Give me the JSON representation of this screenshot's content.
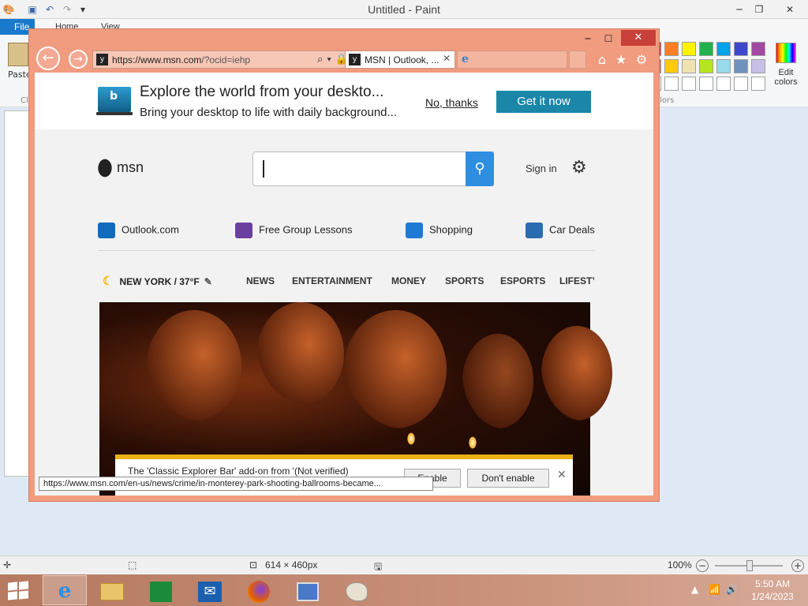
{
  "paint": {
    "title": "Untitled - Paint",
    "tabs": [
      "File",
      "Home",
      "View"
    ],
    "paste_label": "Paste",
    "clipboard_label": "Cl",
    "colors_label": "olors",
    "edit_colors_label": "Edit colors",
    "palette_row1": [
      "#e81123",
      "#ff7f27",
      "#fff200",
      "#22b14c",
      "#00a2e8",
      "#3f48cc",
      "#a349a4"
    ],
    "palette_row2": [
      "#b97a57",
      "#ffc90e",
      "#efe4b0",
      "#b5e61d",
      "#99d9ea",
      "#7092be",
      "#c8bfe7"
    ],
    "status": {
      "dimensions": "614 × 460px",
      "zoom": "100%"
    }
  },
  "ie": {
    "url_main": "https://www.msn.com",
    "url_rest": "/?ocid=iehp",
    "tab_title": "MSN | Outlook, ...",
    "banner": {
      "headline": "Explore the world from your deskto...",
      "sub": "Bring your desktop to life with daily background...",
      "no_thanks": "No, thanks",
      "get_it_now": "Get it now"
    },
    "msn_logo": "msn",
    "sign_in": "Sign in",
    "quick_links": [
      {
        "label": "Outlook.com",
        "icon": "outlook-icon",
        "color": "#0f6cbd"
      },
      {
        "label": "Free Group Lessons",
        "icon": "graduation-cap-icon",
        "color": "#6b3fa0"
      },
      {
        "label": "Shopping",
        "icon": "shopping-cart-icon",
        "color": "#1f7ad6"
      },
      {
        "label": "Car Deals",
        "icon": "car-icon",
        "color": "#2b6cb0"
      }
    ],
    "weather": "NEW YORK / 37°F",
    "nav_links": [
      "NEWS",
      "ENTERTAINMENT",
      "MONEY",
      "SPORTS",
      "ESPORTS",
      "LIFESTY"
    ],
    "addon": {
      "message": "The 'Classic Explorer Bar' add-on from '(Not verified)",
      "enable": "Enable",
      "dont_enable": "Don't enable"
    },
    "status_url": "https://www.msn.com/en-us/news/crime/in-monterey-park-shooting-ballrooms-became..."
  },
  "taskbar": {
    "apps": [
      "internet-explorer",
      "file-explorer",
      "store",
      "mail",
      "firefox",
      "remote-desktop",
      "paint"
    ],
    "time": "5:50 AM",
    "date": "1/24/2023"
  }
}
